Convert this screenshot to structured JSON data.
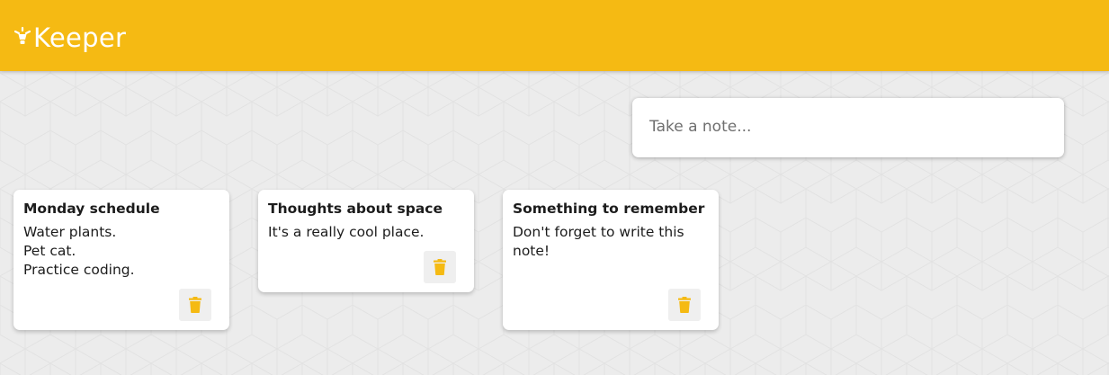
{
  "header": {
    "title": "Keeper",
    "icon": "lightbulb-icon",
    "background_color": "#f5ba13"
  },
  "create_note": {
    "placeholder": "Take a note..."
  },
  "notes": [
    {
      "title": "Monday schedule",
      "content": "Water plants.\nPet cat.\nPractice coding.",
      "delete_icon": "trash-icon"
    },
    {
      "title": "Thoughts about space",
      "content": "It's a really cool place.",
      "delete_icon": "trash-icon"
    },
    {
      "title": "Something to remember",
      "content": "Don't forget to write this note!",
      "delete_icon": "trash-icon"
    }
  ],
  "colors": {
    "accent": "#f5ba13",
    "background": "#ececec",
    "card": "#ffffff"
  }
}
